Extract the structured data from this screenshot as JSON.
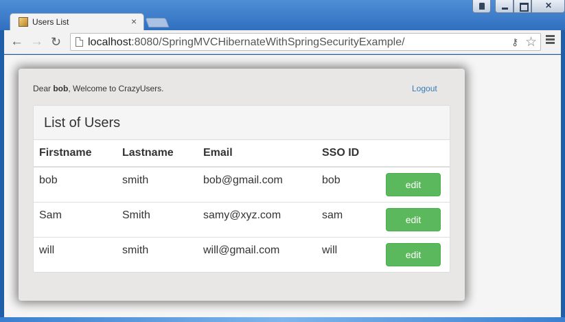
{
  "browser": {
    "tab_title": "Users List",
    "tab_close": "×",
    "url_host": "localhost",
    "url_rest": ":8080/SpringMVCHibernateWithSpringSecurityExample/",
    "nav_back": "←",
    "nav_forward": "→",
    "nav_reload": "↻"
  },
  "header": {
    "welcome_prefix": "Dear ",
    "username": "bob",
    "welcome_suffix": ", Welcome to CrazyUsers.",
    "logout_label": "Logout"
  },
  "panel": {
    "title": "List of Users"
  },
  "table": {
    "columns": [
      "Firstname",
      "Lastname",
      "Email",
      "SSO ID",
      ""
    ],
    "rows": [
      {
        "firstname": "bob",
        "lastname": "smith",
        "email": "bob@gmail.com",
        "sso_id": "bob",
        "action": "edit"
      },
      {
        "firstname": "Sam",
        "lastname": "Smith",
        "email": "samy@xyz.com",
        "sso_id": "sam",
        "action": "edit"
      },
      {
        "firstname": "will",
        "lastname": "smith",
        "email": "will@gmail.com",
        "sso_id": "will",
        "action": "edit"
      }
    ]
  },
  "colors": {
    "edit_button": "#5cb85c",
    "logout_link": "#337ab7"
  }
}
